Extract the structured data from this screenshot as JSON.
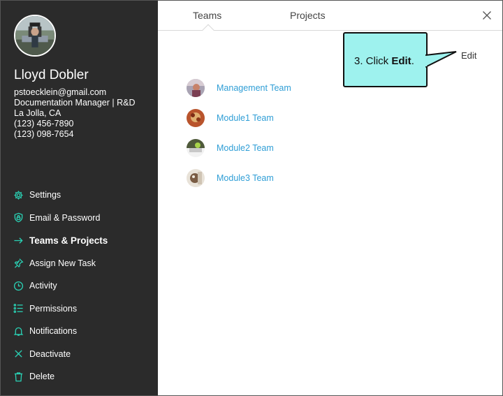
{
  "user": {
    "name": "Lloyd Dobler",
    "email": "pstoecklein@gmail.com",
    "title": "Documentation Manager | R&D",
    "location": "La Jolla, CA",
    "phone1": "(123) 456-7890",
    "phone2": "(123) 098-7654"
  },
  "nav": {
    "items": [
      {
        "label": "Settings",
        "icon": "gear-icon"
      },
      {
        "label": "Email & Password",
        "icon": "shield-icon"
      },
      {
        "label": "Teams & Projects",
        "icon": "arrow-right-icon",
        "active": true
      },
      {
        "label": "Assign New Task",
        "icon": "pin-icon"
      },
      {
        "label": "Activity",
        "icon": "clock-icon"
      },
      {
        "label": "Permissions",
        "icon": "list-icon"
      },
      {
        "label": "Notifications",
        "icon": "bell-icon"
      },
      {
        "label": "Deactivate",
        "icon": "x-icon"
      },
      {
        "label": "Delete",
        "icon": "trash-icon"
      }
    ]
  },
  "tabs": {
    "teams": "Teams",
    "projects": "Projects",
    "active": "Teams"
  },
  "main": {
    "edit_label": "Edit"
  },
  "teams": [
    {
      "name": "Management Team"
    },
    {
      "name": "Module1 Team"
    },
    {
      "name": "Module2 Team"
    },
    {
      "name": "Module3 Team"
    }
  ],
  "callout": {
    "prefix": "3. Click ",
    "action": "Edit",
    "suffix": "."
  },
  "colors": {
    "sidebar_bg": "#2b2b2b",
    "accent": "#2ad1b4",
    "link": "#2f9ed6",
    "callout_bg": "#9ef2ee"
  }
}
